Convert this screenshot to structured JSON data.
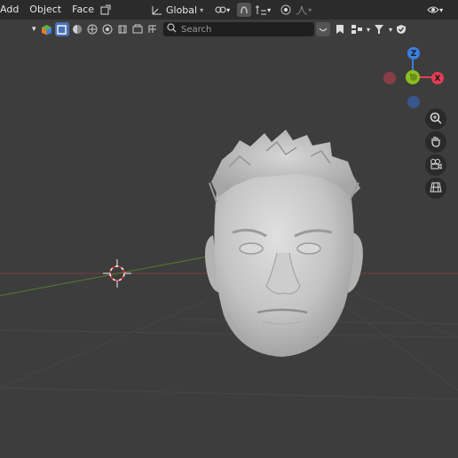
{
  "header": {
    "menu": [
      {
        "label": "Add"
      },
      {
        "label": "Object"
      },
      {
        "label": "Face"
      }
    ],
    "orientation": {
      "label": "Global"
    }
  },
  "viewport_header": {
    "search": {
      "placeholder": "Search"
    }
  },
  "gizmo": {
    "axes": [
      {
        "label": "Z",
        "color": "#3b7fe0"
      },
      {
        "label": "X",
        "color": "#e23d54"
      },
      {
        "label": "Y",
        "color": "#8bbf1e"
      }
    ]
  },
  "colors": {
    "background": "#3d3d3d",
    "header": "#2b2b2b",
    "active": "#4772b3",
    "mesh": "#c8c8c8"
  }
}
